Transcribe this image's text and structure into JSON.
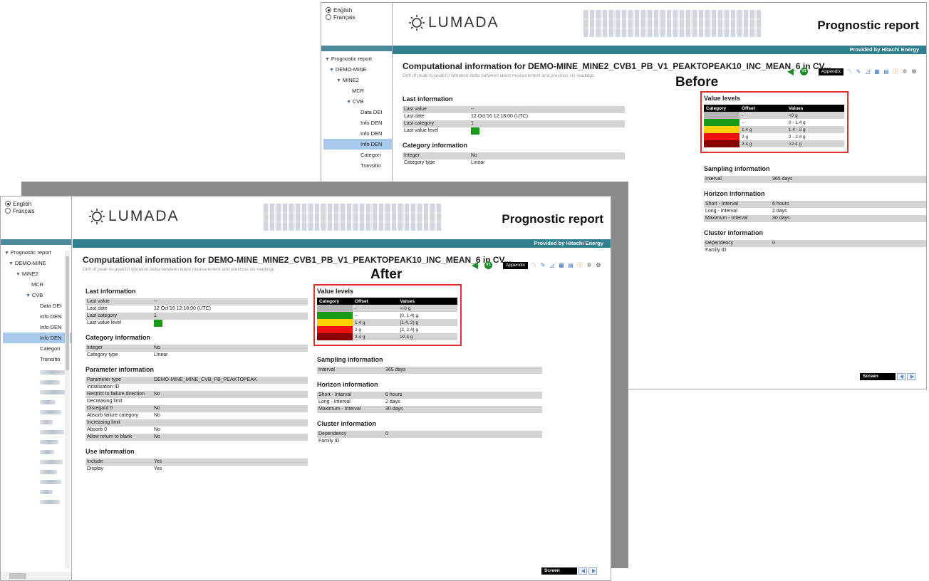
{
  "languages": [
    {
      "label": "English",
      "selected": true
    },
    {
      "label": "Français",
      "selected": false
    }
  ],
  "header": {
    "logo_text": "LUMADA",
    "report_title": "Prognostic report",
    "provided_by": "Provided by Hitachi Energy"
  },
  "tree": {
    "root": "Prognostic report",
    "demo_mine": "DEMO-MINE",
    "mine2": "MINE2",
    "mcr": "MCR",
    "cvb": "CVB",
    "leaves": [
      "Data DEI",
      "Info DEN",
      "Info DEN",
      "Info DEN",
      "Categori",
      "Transitio"
    ]
  },
  "computation": {
    "title_before": "Computational information for DEMO-MINE_MINE2_CVB1_PB_V1_PEAKTOPEAK10_INC_MEAN_6 in CV...",
    "title_after": "Computational information for DEMO-MINE_MINE2_CVB1_PB_V1_PEAKTOPEAK10_INC_MEAN_6 in CV...",
    "subtitle": "Drift of peak-to-peak10 vibration:delta between latest measurement and previous six readings",
    "badge": "V1",
    "appendix_label": "Appendix"
  },
  "labels": {
    "before": "Before",
    "after": "After"
  },
  "last_information": {
    "title": "Last information",
    "rows": [
      {
        "k": "Last value",
        "v": "--"
      },
      {
        "k": "Last date",
        "v": "12 Oct'16 12:18:00 (UTC)"
      },
      {
        "k": "Last category",
        "v": "1"
      },
      {
        "k": "Last value level",
        "v": ""
      }
    ]
  },
  "category_information": {
    "title": "Category information",
    "rows": [
      {
        "k": "Integer",
        "v": "No"
      },
      {
        "k": "Category type",
        "v": "Linear"
      }
    ]
  },
  "parameter_information": {
    "title": "Parameter information",
    "rows": [
      {
        "k": "Parameter type",
        "v": "DEMO-MINE_MINE_CVB_PB_PEAKTOPEAK"
      },
      {
        "k": "Initialization ID",
        "v": ""
      },
      {
        "k": "Restrict to failure direction",
        "v": "No"
      },
      {
        "k": "Decreasing limit",
        "v": ""
      },
      {
        "k": "Disregard 0",
        "v": "No"
      },
      {
        "k": "Absorb failure category",
        "v": "No"
      },
      {
        "k": "Increasing limit",
        "v": ""
      },
      {
        "k": "Absorb 0",
        "v": "No"
      },
      {
        "k": "Allow return to blank",
        "v": "No"
      }
    ]
  },
  "use_information": {
    "title": "Use information",
    "rows": [
      {
        "k": "Include",
        "v": "Yes"
      },
      {
        "k": "Display",
        "v": "Yes"
      }
    ]
  },
  "value_levels": {
    "title": "Value levels",
    "headers": [
      "Category",
      "Offset",
      "Values"
    ],
    "colors": [
      "#b4b4b4",
      "#1a9a1a",
      "#ffd200",
      "#f01010",
      "#8b0000"
    ],
    "before_rows": [
      {
        "offset": "-",
        "values": "<0 g"
      },
      {
        "offset": "--",
        "values": "0 - 1.4 g"
      },
      {
        "offset": "1.4 g",
        "values": "1.4 - 2 g"
      },
      {
        "offset": "2 g",
        "values": "2 - 2.4 g"
      },
      {
        "offset": "2.4 g",
        "values": ">2.4 g"
      }
    ],
    "after_rows": [
      {
        "offset": "-",
        "values": "<-0 g"
      },
      {
        "offset": "--",
        "values": "[0, 1.4) g"
      },
      {
        "offset": "1.4 g",
        "values": "[1.4, 2) g"
      },
      {
        "offset": "2 g",
        "values": "[2, 2.4) g"
      },
      {
        "offset": "2.4 g",
        "values": "≥2.4 g"
      }
    ]
  },
  "sampling_information": {
    "title": "Sampling information",
    "rows": [
      {
        "k": "Interval",
        "v": "365 days"
      }
    ]
  },
  "horizon_information": {
    "title": "Horizon information",
    "rows": [
      {
        "k": "Short - Interval",
        "v": "6 hours"
      },
      {
        "k": "Long - Interval",
        "v": "2 days"
      },
      {
        "k": "Maximum - Interval",
        "v": "30 days"
      }
    ]
  },
  "cluster_information": {
    "title": "Cluster information",
    "rows": [
      {
        "k": "Dependency",
        "v": "0"
      },
      {
        "k": "Family ID",
        "v": ""
      }
    ]
  },
  "screen_label": "Screen",
  "accent_colors": {
    "teal": "#2f7f8f",
    "highlight": "#e03030",
    "green": "#1e8c2a"
  }
}
